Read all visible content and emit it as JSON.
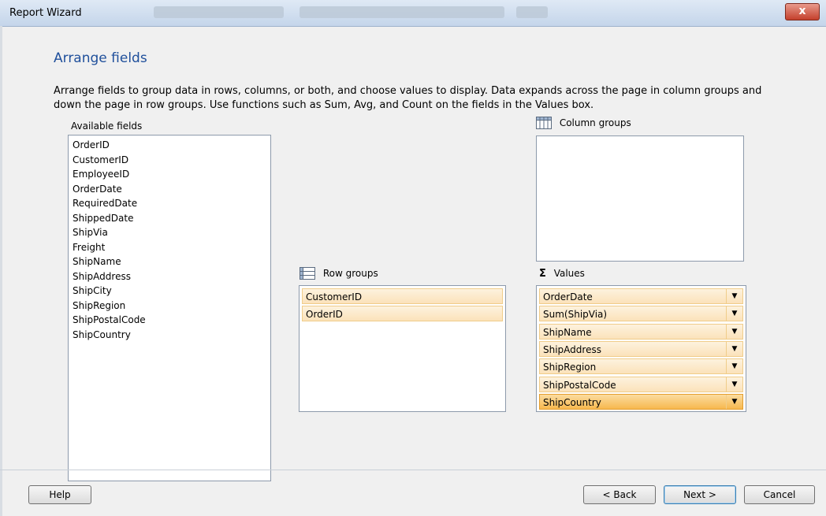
{
  "window": {
    "title": "Report Wizard",
    "close_label": "x"
  },
  "page": {
    "heading": "Arrange fields",
    "description": "Arrange fields to group data in rows, columns, or both, and choose values to display. Data expands across the page in column groups and down the page in row groups.  Use functions such as Sum, Avg, and Count on the fields in the Values box."
  },
  "available_fields": {
    "label": "Available fields",
    "items": [
      "OrderID",
      "CustomerID",
      "EmployeeID",
      "OrderDate",
      "RequiredDate",
      "ShippedDate",
      "ShipVia",
      "Freight",
      "ShipName",
      "ShipAddress",
      "ShipCity",
      "ShipRegion",
      "ShipPostalCode",
      "ShipCountry"
    ]
  },
  "column_groups": {
    "label": "Column groups",
    "icon": "table-columns-icon",
    "items": []
  },
  "row_groups": {
    "label": "Row groups",
    "icon": "table-rows-icon",
    "items": [
      "CustomerID",
      "OrderID"
    ]
  },
  "values": {
    "label": "Values",
    "icon": "sigma-icon",
    "icon_glyph": "Σ",
    "items": [
      "OrderDate",
      "Sum(ShipVia)",
      "ShipName",
      "ShipAddress",
      "ShipRegion",
      "ShipPostalCode",
      "ShipCountry"
    ],
    "selected": "ShipCountry"
  },
  "buttons": {
    "help": "Help",
    "back": "< Back",
    "next": "Next >",
    "cancel": "Cancel"
  },
  "colors": {
    "heading": "#1f4f9b",
    "group_item": "#fbe2ba",
    "group_item_selected": "#f7b84f"
  }
}
